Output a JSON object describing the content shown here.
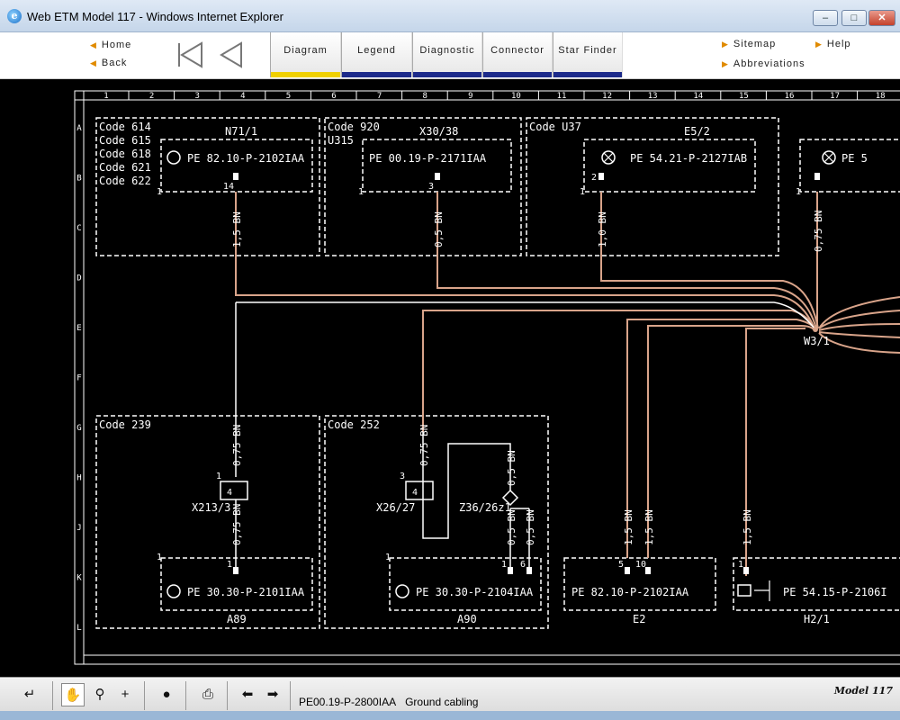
{
  "window": {
    "title": "Web ETM Model 117 - Windows Internet Explorer",
    "icon": "internet-explorer-icon",
    "controls": [
      "minimize-icon",
      "maximize-icon",
      "close-icon"
    ]
  },
  "nav": {
    "home": "Home",
    "back": "Back",
    "sitemap": "Sitemap",
    "help": "Help",
    "abbreviations": "Abbreviations"
  },
  "tabs": [
    {
      "label": "Diagram",
      "active": true
    },
    {
      "label": "Legend",
      "active": false
    },
    {
      "label": "Diagnostic",
      "active": false
    },
    {
      "label": "Connector",
      "active": false
    },
    {
      "label": "Star Finder",
      "active": false
    }
  ],
  "diagram": {
    "columns": [
      "1",
      "2",
      "3",
      "4",
      "5",
      "6",
      "7",
      "8",
      "9",
      "10",
      "11",
      "12",
      "13",
      "14",
      "15",
      "16",
      "17",
      "18"
    ],
    "rows": [
      "A",
      "B",
      "C",
      "D",
      "E",
      "F",
      "G",
      "H",
      "J",
      "K",
      "L"
    ],
    "wire_color": "#d9a48a",
    "line_color": "#ffffff",
    "boxes": {
      "n71": {
        "codes": [
          "Code 614",
          "Code 615",
          "Code 618",
          "Code 621",
          "Code 622"
        ],
        "name": "N71/1",
        "ref": "PE 82.10-P-2102IAA",
        "pin": "14",
        "pin_left": "1"
      },
      "x30": {
        "codes": [
          "Code 920",
          "U315"
        ],
        "name": "X30/38",
        "ref": "PE 00.19-P-2171IAA",
        "pin": "3",
        "pin_left": "1"
      },
      "e5": {
        "codes": [
          "Code U37"
        ],
        "name": "E5/2",
        "ref": "PE 54.21-P-2127IAB",
        "pin": "2",
        "pin_left": "1"
      },
      "e5b": {
        "ref": "PE 5",
        "pin_left": "1"
      },
      "a89": {
        "codes": [
          "Code 239"
        ],
        "name": "A89",
        "ref": "PE 30.30-P-2101IAA",
        "pin": "1",
        "pin_left": "1"
      },
      "a90": {
        "codes": [
          "Code 252"
        ],
        "name": "A90",
        "ref": "PE 30.30-P-2104IAA",
        "pin1": "1",
        "pin2": "6",
        "pin_left": "1"
      },
      "e2": {
        "name": "E2",
        "ref": "PE 82.10-P-2102IAA",
        "pin1": "5",
        "pin2": "10"
      },
      "h2": {
        "name": "H2/1",
        "ref": "PE 54.15-P-2106I",
        "pin": "1"
      }
    },
    "connectors": {
      "x213": {
        "name": "X213/3",
        "pin_top": "1",
        "pin_in": "4"
      },
      "x26": {
        "name": "X26/27",
        "pin_top": "3",
        "pin_in": "4"
      },
      "z36": {
        "name": "Z36/26z1"
      },
      "w3": {
        "name": "W3/1"
      }
    },
    "wires": {
      "w1": "1,5 BN",
      "w2": "0,5 BN",
      "w3": "1,0 BN",
      "w4": "0,75 BN",
      "w5": "0,75 BN",
      "w6": "0,75 BN",
      "w7": "0,75 BN",
      "w8": "0,5 BN",
      "w9": "0,5 BN",
      "w10": "0,5 BN",
      "w11": "1,5 BN",
      "w12": "1,5 BN",
      "w13": "1,5 BN"
    }
  },
  "status": {
    "doc_ref": "PE00.19-P-2800IAA",
    "doc_title": "Ground cabling",
    "model": "Model 117",
    "tools": [
      "return-icon",
      "hand-icon",
      "zoom-icon",
      "crosshair-icon",
      "lightbulb-icon",
      "print-icon",
      "arrow-left-icon",
      "arrow-right-icon"
    ]
  }
}
